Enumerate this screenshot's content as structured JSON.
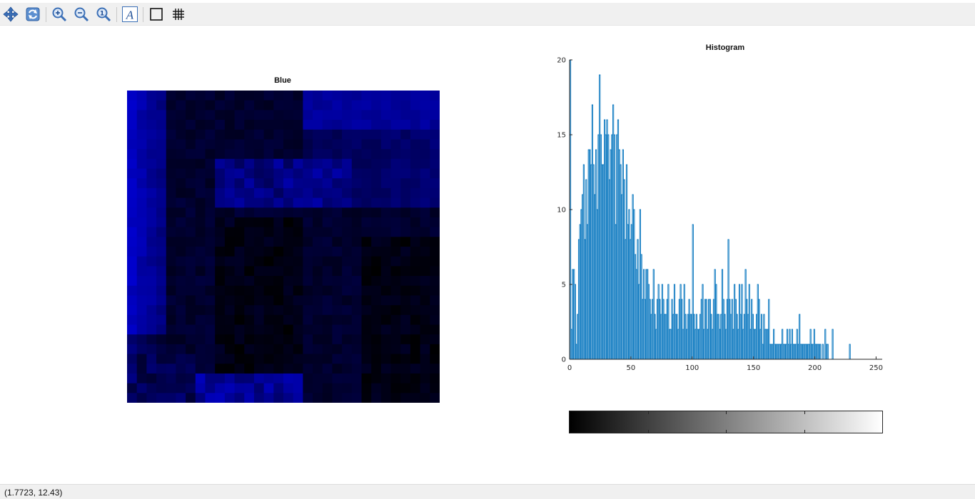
{
  "toolbar": {
    "buttons": [
      {
        "id": "pan",
        "icon": "pan-arrows-icon"
      },
      {
        "id": "rotate",
        "icon": "rotate-icon"
      },
      {
        "id": "zoom-in",
        "icon": "zoom-in-icon"
      },
      {
        "id": "zoom-out",
        "icon": "zoom-out-icon"
      },
      {
        "id": "zoom-reset",
        "icon": "zoom-reset-icon"
      },
      {
        "id": "text",
        "icon": "text-annotation-icon",
        "glyph": "A"
      },
      {
        "id": "axes-box",
        "icon": "axes-box-icon"
      },
      {
        "id": "grid",
        "icon": "grid-icon"
      }
    ]
  },
  "image_plot": {
    "title": "Blue",
    "grid_size": 32,
    "color_base": "#0000ff"
  },
  "histogram": {
    "title": "Histogram",
    "bar_color": "#0072bd"
  },
  "chart_data": [
    {
      "type": "heatmap",
      "title": "Blue",
      "colormap": "blue-intensity"
    },
    {
      "type": "bar",
      "title": "Histogram",
      "xlim": [
        0,
        255
      ],
      "ylim": [
        0,
        20
      ],
      "xticks": [
        0,
        50,
        100,
        150,
        200,
        250
      ],
      "yticks": [
        0,
        5,
        10,
        15,
        20
      ],
      "grid": false,
      "x": [
        0,
        1,
        2,
        3,
        4,
        5,
        6,
        7,
        8,
        9,
        10,
        11,
        12,
        13,
        14,
        15,
        16,
        17,
        18,
        19,
        20,
        21,
        22,
        23,
        24,
        25,
        26,
        27,
        28,
        29,
        30,
        31,
        32,
        33,
        34,
        35,
        36,
        37,
        38,
        39,
        40,
        41,
        42,
        43,
        44,
        45,
        46,
        47,
        48,
        49,
        50,
        51,
        52,
        53,
        54,
        55,
        56,
        57,
        58,
        59,
        60,
        61,
        62,
        63,
        64,
        65,
        66,
        67,
        68,
        69,
        70,
        71,
        72,
        73,
        74,
        75,
        76,
        77,
        78,
        79,
        80,
        81,
        82,
        83,
        84,
        85,
        86,
        87,
        88,
        89,
        90,
        91,
        92,
        93,
        94,
        95,
        96,
        97,
        98,
        99,
        100,
        101,
        102,
        103,
        104,
        105,
        106,
        107,
        108,
        109,
        110,
        111,
        112,
        113,
        114,
        115,
        116,
        117,
        118,
        119,
        120,
        121,
        122,
        123,
        124,
        125,
        126,
        127,
        128,
        129,
        130,
        131,
        132,
        133,
        134,
        135,
        136,
        137,
        138,
        139,
        140,
        141,
        142,
        143,
        144,
        145,
        146,
        147,
        148,
        149,
        150,
        151,
        152,
        153,
        154,
        155,
        156,
        157,
        158,
        159,
        160,
        161,
        162,
        163,
        164,
        165,
        166,
        167,
        168,
        169,
        170,
        171,
        172,
        173,
        174,
        175,
        176,
        177,
        178,
        179,
        180,
        181,
        182,
        183,
        184,
        185,
        186,
        187,
        188,
        189,
        190,
        191,
        192,
        193,
        194,
        195,
        196,
        197,
        198,
        199,
        200,
        201,
        202,
        203,
        204,
        205,
        206,
        207,
        208,
        209,
        210,
        211,
        212,
        213,
        214,
        215,
        216,
        217,
        218,
        219,
        220,
        221,
        222,
        223,
        224,
        225,
        226,
        227,
        228,
        229,
        230,
        231,
        232,
        233,
        234,
        235,
        236,
        237,
        238,
        239,
        240,
        241,
        242,
        243,
        244,
        245,
        246,
        247,
        248,
        249,
        250,
        251,
        252,
        253,
        254,
        255
      ],
      "values": [
        20,
        2,
        6,
        6,
        5,
        1,
        3,
        8,
        9,
        10,
        11,
        13,
        8,
        12,
        9,
        14,
        14,
        13,
        17,
        13,
        11,
        14,
        10,
        15,
        19,
        15,
        13,
        13,
        16,
        15,
        16,
        15,
        12,
        14,
        15,
        17,
        15,
        9,
        15,
        16,
        14,
        13,
        11,
        14,
        12,
        8,
        13,
        9,
        10,
        8,
        9,
        11,
        10,
        7,
        6,
        8,
        5,
        10,
        7,
        4,
        6,
        4,
        6,
        6,
        5,
        4,
        3,
        4,
        6,
        3,
        2,
        4,
        5,
        4,
        3,
        5,
        4,
        3,
        3,
        4,
        5,
        2,
        2,
        4,
        3,
        5,
        3,
        3,
        2,
        4,
        5,
        4,
        2,
        5,
        3,
        2,
        3,
        4,
        3,
        3,
        9,
        3,
        2,
        3,
        2,
        2,
        3,
        4,
        5,
        2,
        4,
        4,
        2,
        4,
        4,
        3,
        2,
        4,
        6,
        5,
        3,
        3,
        2,
        3,
        6,
        4,
        3,
        2,
        4,
        8,
        4,
        3,
        4,
        2,
        5,
        4,
        3,
        2,
        5,
        3,
        5,
        2,
        3,
        6,
        4,
        3,
        5,
        2,
        4,
        3,
        2,
        2,
        3,
        5,
        4,
        2,
        3,
        1,
        3,
        2,
        2,
        2,
        4,
        1,
        1,
        1,
        2,
        1,
        1,
        1,
        1,
        1,
        1,
        2,
        1,
        1,
        1,
        2,
        1,
        2,
        1,
        2,
        1,
        1,
        1,
        2,
        1,
        3,
        1,
        1,
        1,
        1,
        1,
        1,
        1,
        1,
        2,
        1,
        1,
        2,
        1,
        1,
        1,
        1,
        1,
        0,
        1,
        0,
        2,
        1,
        1,
        0,
        0,
        0,
        2,
        0,
        0,
        0,
        0,
        0,
        0,
        0,
        0,
        0,
        0,
        0,
        0,
        0,
        1,
        0,
        0,
        0,
        0,
        0,
        0,
        0,
        0,
        0,
        0,
        0,
        0,
        0,
        0,
        0,
        0,
        0,
        0,
        0,
        0,
        0,
        0,
        0,
        0,
        0,
        0,
        0,
        0,
        0,
        0,
        0,
        0,
        0,
        0,
        0
      ]
    }
  ],
  "colorbar": {
    "from_color": "#000000",
    "to_color": "#ffffff",
    "tick_fractions": [
      0.25,
      0.5,
      0.75
    ]
  },
  "status": {
    "coordinates": "(1.7723, 12.43)"
  }
}
